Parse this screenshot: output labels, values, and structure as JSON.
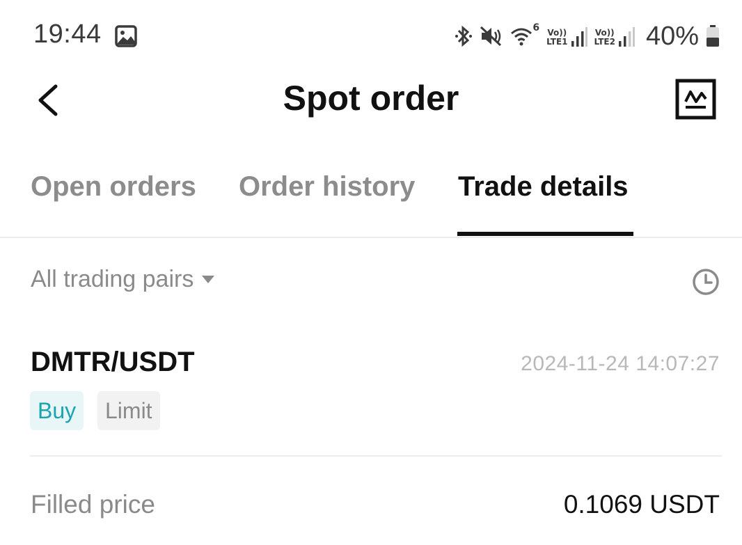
{
  "status_bar": {
    "time": "19:44",
    "battery": "40%",
    "sim1": "LTE1",
    "sim2": "LTE2",
    "volte": "Vo))",
    "wifi_badge": "6",
    "icons": [
      "gallery-icon",
      "bluetooth-icon",
      "mute-icon",
      "wifi-icon",
      "signal-icon",
      "battery-icon"
    ]
  },
  "header": {
    "title": "Spot order",
    "back_icon": "back-arrow-icon",
    "chart_icon": "chart-icon"
  },
  "tabs": [
    {
      "label": "Open orders",
      "active": false
    },
    {
      "label": "Order history",
      "active": false
    },
    {
      "label": "Trade details",
      "active": true
    }
  ],
  "filter": {
    "label": "All trading pairs",
    "clock_icon": "clock-icon"
  },
  "trade": {
    "pair": "DMTR/USDT",
    "time": "2024-11-24 14:07:27",
    "side": "Buy",
    "type": "Limit",
    "filled_price_label": "Filled price",
    "filled_price_value": "0.1069 USDT"
  },
  "colors": {
    "buy_text": "#1aa3b0",
    "buy_bg": "#e8f6f7",
    "inactive_text": "#8c8c8c",
    "primary_text": "#111111"
  }
}
